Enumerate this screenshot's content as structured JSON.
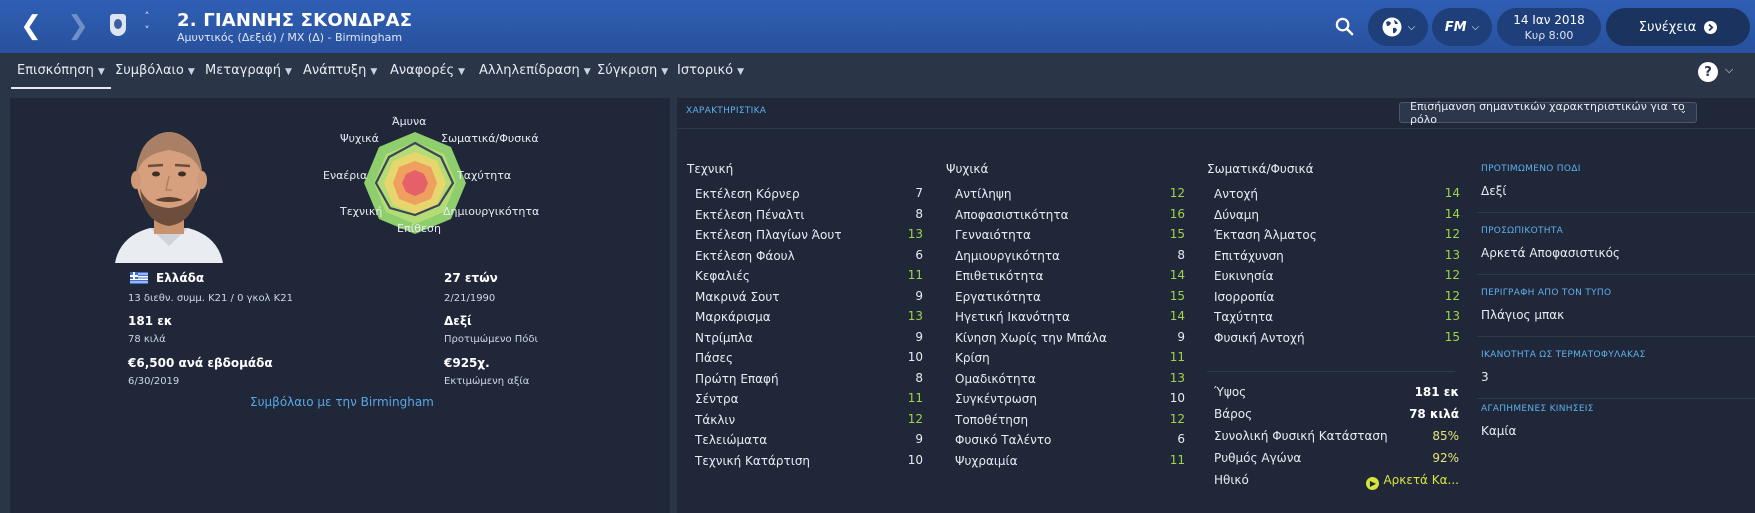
{
  "header": {
    "title": "2. ΓΙΑΝΝΗΣ ΣΚΟΝΔΡΑΣ",
    "subtitle": "Αμυντικός (Δεξιά) / ΜΧ (Δ) - Birmingham",
    "date": "14 Ιαν 2018",
    "time": "Κυρ 8:00",
    "continue_label": "Συνέχεια",
    "fm_label": "FM"
  },
  "tabs": [
    {
      "label": "Επισκόπηση"
    },
    {
      "label": "Συμβόλαιο"
    },
    {
      "label": "Μεταγραφή"
    },
    {
      "label": "Ανάπτυξη"
    },
    {
      "label": "Αναφορές"
    },
    {
      "label": "Αλληλεπίδραση"
    },
    {
      "label": "Σύγκριση"
    },
    {
      "label": "Ιστορικό"
    }
  ],
  "profile": {
    "nationality": "Ελλάδα",
    "caps": "13 διεθν. συμμ. Κ21 / 0 γκολ Κ21",
    "age": "27 ετών",
    "dob": "2/21/1990",
    "height": "181 εκ",
    "weight": "78 κιλά",
    "foot": "Δεξί",
    "foot_label": "Προτιμώμενο Πόδι",
    "wage": "€6,500 ανά εβδομάδα",
    "contract_end": "6/30/2019",
    "value": "€925χ.",
    "value_label": "Εκτιμώμενη αξία",
    "contract_link": "Συμβόλαιο με την Birmingham"
  },
  "radar": {
    "top": "Άμυνα",
    "top_right": "Σωματικά/Φυσικά",
    "right": "Ταχύτητα",
    "bottom_right": "Δημιουργικότητα",
    "bottom": "Επίθεση",
    "bottom_left": "Τεχνική",
    "left": "Εναέρια",
    "top_left": "Ψυχικά"
  },
  "attributes": {
    "section_title": "ΧΑΡΑΚΤΗΡΙΣΤΙΚΑ",
    "highlight_label": "Επισήμανση σημαντικών χαρακτηριστικών για το ρόλο",
    "technical_title": "Τεχνική",
    "technical": [
      {
        "name": "Εκτέλεση Κόρνερ",
        "value": "7",
        "color": "white"
      },
      {
        "name": "Εκτέλεση Πέναλτι",
        "value": "8",
        "color": "white"
      },
      {
        "name": "Εκτέλεση Πλαγίων Άουτ",
        "value": "13",
        "color": "green"
      },
      {
        "name": "Εκτέλεση Φάουλ",
        "value": "6",
        "color": "white"
      },
      {
        "name": "Κεφαλιές",
        "value": "11",
        "color": "green"
      },
      {
        "name": "Μακρινά Σουτ",
        "value": "9",
        "color": "white"
      },
      {
        "name": "Μαρκάρισμα",
        "value": "13",
        "color": "green"
      },
      {
        "name": "Ντρίμπλα",
        "value": "9",
        "color": "white"
      },
      {
        "name": "Πάσες",
        "value": "10",
        "color": "white"
      },
      {
        "name": "Πρώτη Επαφή",
        "value": "8",
        "color": "white"
      },
      {
        "name": "Σέντρα",
        "value": "11",
        "color": "green"
      },
      {
        "name": "Τάκλιν",
        "value": "12",
        "color": "green"
      },
      {
        "name": "Τελειώματα",
        "value": "9",
        "color": "white"
      },
      {
        "name": "Τεχνική Κατάρτιση",
        "value": "10",
        "color": "white"
      }
    ],
    "mental_title": "Ψυχικά",
    "mental": [
      {
        "name": "Αντίληψη",
        "value": "12",
        "color": "green"
      },
      {
        "name": "Αποφασιστικότητα",
        "value": "16",
        "color": "green"
      },
      {
        "name": "Γενναιότητα",
        "value": "15",
        "color": "green"
      },
      {
        "name": "Δημιουργικότητα",
        "value": "8",
        "color": "white"
      },
      {
        "name": "Επιθετικότητα",
        "value": "14",
        "color": "green"
      },
      {
        "name": "Εργατικότητα",
        "value": "15",
        "color": "green"
      },
      {
        "name": "Ηγετική Ικανότητα",
        "value": "14",
        "color": "green"
      },
      {
        "name": "Κίνηση Χωρίς την Μπάλα",
        "value": "9",
        "color": "white"
      },
      {
        "name": "Κρίση",
        "value": "11",
        "color": "green"
      },
      {
        "name": "Ομαδικότητα",
        "value": "13",
        "color": "green"
      },
      {
        "name": "Συγκέντρωση",
        "value": "10",
        "color": "white"
      },
      {
        "name": "Τοποθέτηση",
        "value": "12",
        "color": "green"
      },
      {
        "name": "Φυσικό Ταλέντο",
        "value": "6",
        "color": "white"
      },
      {
        "name": "Ψυχραιμία",
        "value": "11",
        "color": "green"
      }
    ],
    "physical_title": "Σωματικά/Φυσικά",
    "physical": [
      {
        "name": "Αντοχή",
        "value": "14",
        "color": "green"
      },
      {
        "name": "Δύναμη",
        "value": "14",
        "color": "green"
      },
      {
        "name": "Έκταση Άλματος",
        "value": "12",
        "color": "green"
      },
      {
        "name": "Επιτάχυνση",
        "value": "13",
        "color": "green"
      },
      {
        "name": "Ευκινησία",
        "value": "12",
        "color": "green"
      },
      {
        "name": "Ισορροπία",
        "value": "12",
        "color": "green"
      },
      {
        "name": "Ταχύτητα",
        "value": "13",
        "color": "green"
      },
      {
        "name": "Φυσική Αντοχή",
        "value": "15",
        "color": "green"
      }
    ],
    "condition": [
      {
        "name": "Ύψος",
        "value": "181 εκ"
      },
      {
        "name": "Βάρος",
        "value": "78 κιλά"
      },
      {
        "name": "Συνολική Φυσική Κατάσταση",
        "value": "85%"
      },
      {
        "name": "Ρυθμός Αγώνα",
        "value": "92%"
      },
      {
        "name": "Ηθικό",
        "value": "Αρκετά Κα..."
      }
    ]
  },
  "details": [
    {
      "label": "ΠΡΟΤΙΜΩΜΕΝΟ ΠΟΔΙ",
      "value": "Δεξί"
    },
    {
      "label": "ΠΡΟΣΩΠΙΚΟΤΗΤΑ",
      "value": "Αρκετά Αποφασιστικός"
    },
    {
      "label": "ΠΕΡΙΓΡΑΦΗ ΑΠΟ ΤΟΝ ΤΥΠΟ",
      "value": "Πλάγιος μπακ"
    },
    {
      "label": "ΙΚΑΝΟΤΗΤΑ ΩΣ ΤΕΡΜΑΤΟΦΥΛΑΚΑΣ",
      "value": "3"
    },
    {
      "label": "ΑΓΑΠΗΜΕΝΕΣ ΚΙΝΗΣΕΙΣ",
      "value": "Καμία"
    }
  ],
  "colors": {
    "header_blue": "#2c5aac",
    "panel_bg": "#1f2738",
    "good_attr": "#9fd44a",
    "accent_link": "#59a7e6"
  }
}
